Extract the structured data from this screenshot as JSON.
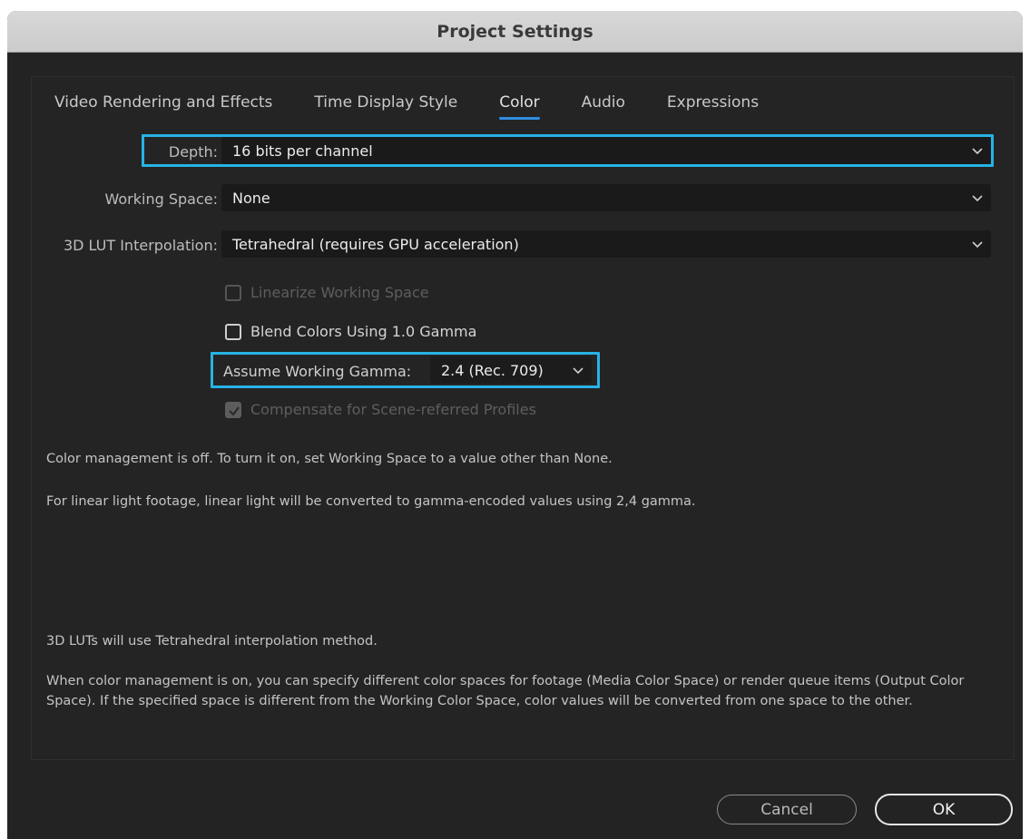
{
  "window": {
    "title": "Project Settings"
  },
  "tabs": [
    {
      "label": "Video Rendering and Effects"
    },
    {
      "label": "Time Display Style"
    },
    {
      "label": "Color",
      "active": true
    },
    {
      "label": "Audio"
    },
    {
      "label": "Expressions"
    }
  ],
  "fields": {
    "depth": {
      "label": "Depth:",
      "value": "16 bits per channel"
    },
    "working_space": {
      "label": "Working Space:",
      "value": "None"
    },
    "lut_interpolation": {
      "label": "3D LUT Interpolation:",
      "value": "Tetrahedral (requires GPU acceleration)"
    },
    "working_gamma": {
      "label": "Assume Working Gamma:",
      "value": "2.4 (Rec. 709)"
    }
  },
  "checkboxes": {
    "linearize": {
      "label": "Linearize Working Space",
      "checked": false,
      "enabled": false
    },
    "blend_gamma": {
      "label": "Blend Colors Using 1.0 Gamma",
      "checked": false,
      "enabled": true
    },
    "compensate": {
      "label": "Compensate for Scene-referred Profiles",
      "checked": true,
      "enabled": false
    }
  },
  "info": {
    "management_off": "Color management is off. To turn it on, set Working Space to a value other than None.",
    "linear_light": "For linear light footage, linear light will be converted to gamma-encoded values using 2,4 gamma.",
    "lut_method": "3D LUTs will use Tetrahedral interpolation method.",
    "management_on": "When color management is on, you can specify different color spaces for footage (Media Color Space) or render queue items (Output Color Space). If the specified space is different from the Working Color Space, color values will be converted from one space to the other."
  },
  "buttons": {
    "cancel": "Cancel",
    "ok": "OK"
  },
  "colors": {
    "highlight": "#27b3e6",
    "tab_accent": "#2f8de0",
    "background": "#232323"
  }
}
